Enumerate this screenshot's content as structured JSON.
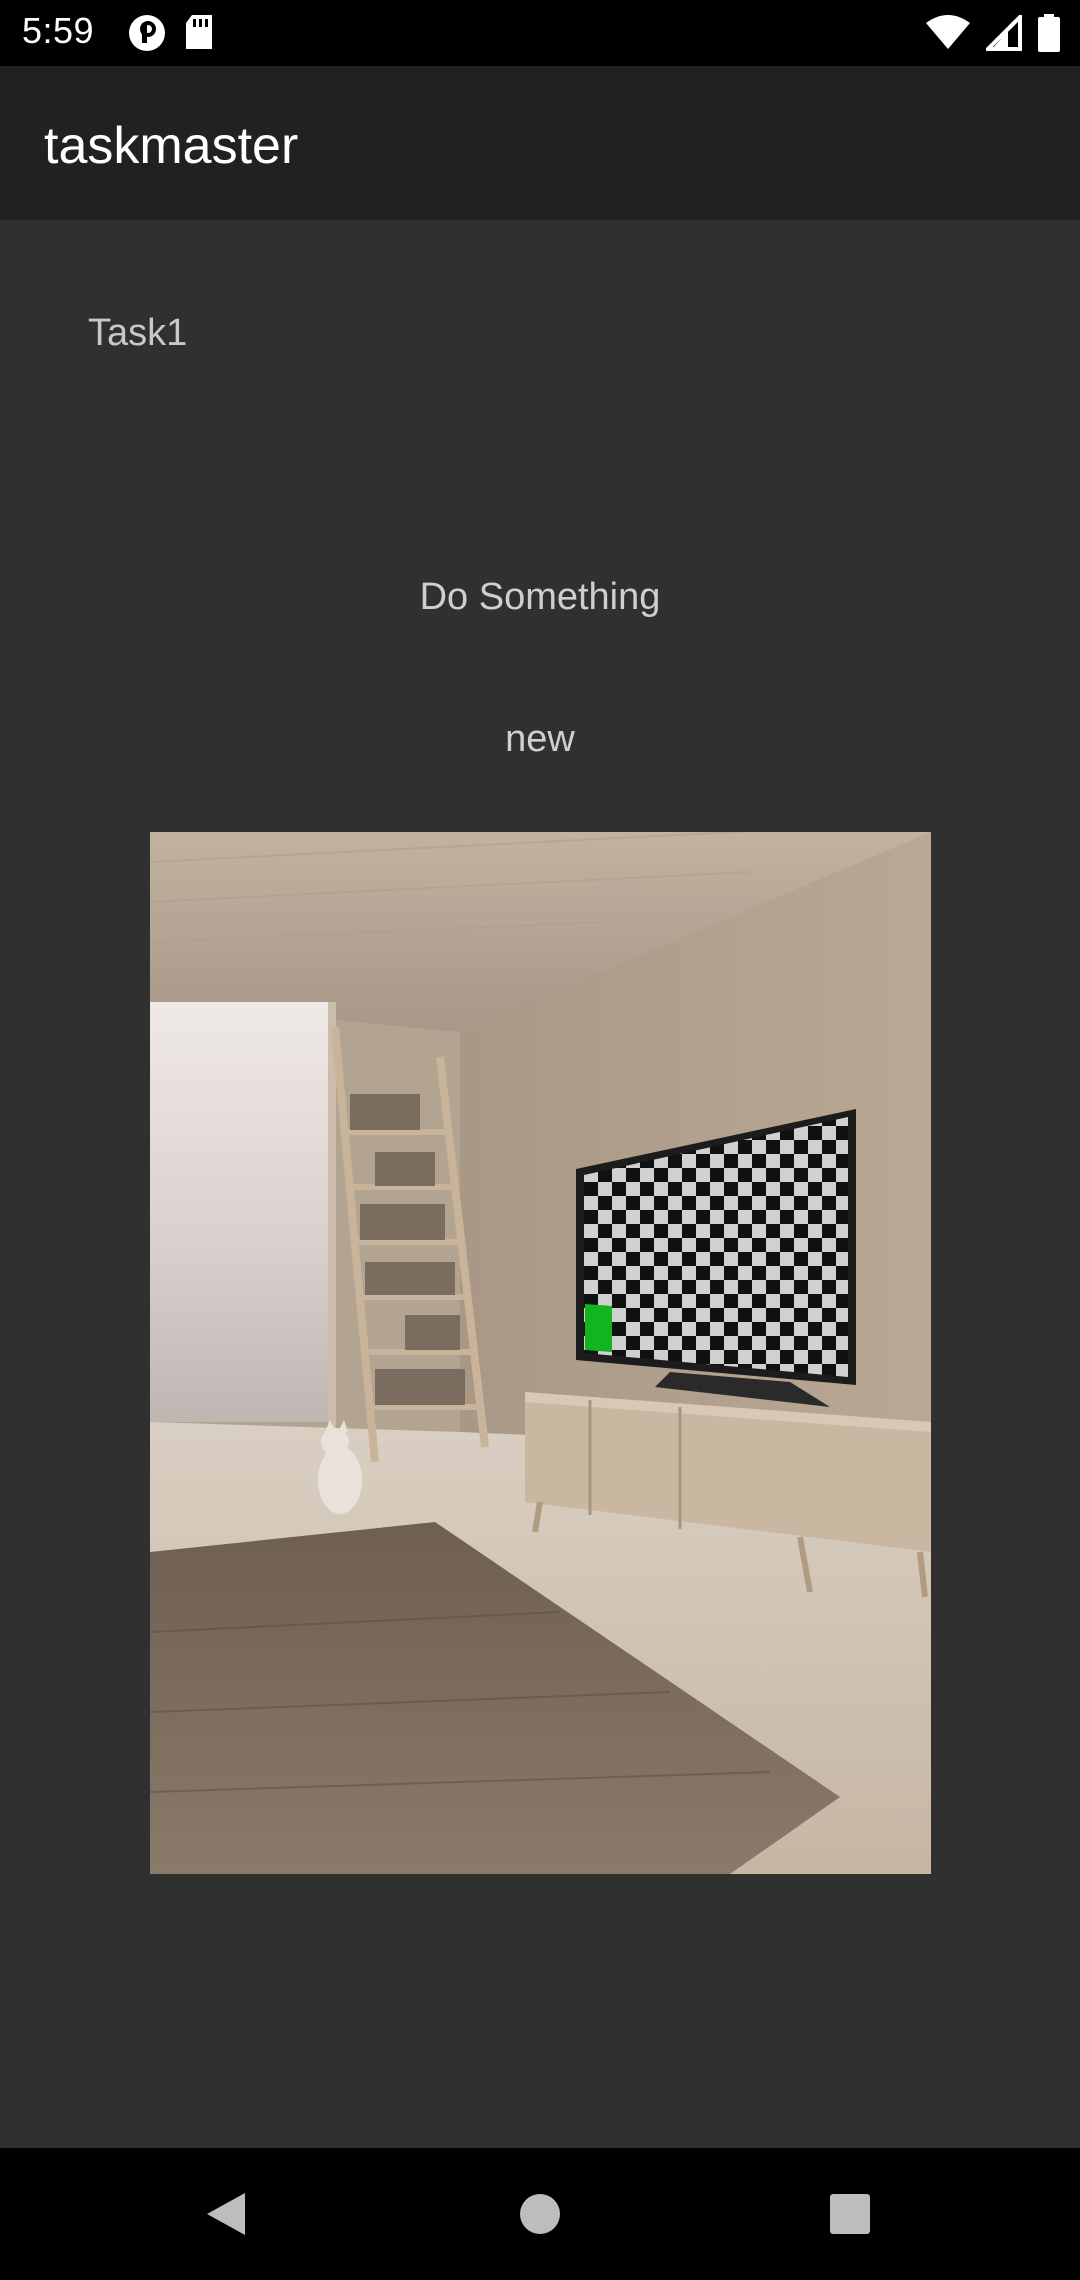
{
  "status_bar": {
    "time": "5:59",
    "left_icons": [
      "notification-p-icon",
      "sd-card-icon"
    ],
    "right_icons": [
      "wifi-icon",
      "cell-signal-icon",
      "battery-icon"
    ]
  },
  "app_bar": {
    "title": "taskmaster"
  },
  "task": {
    "title": "Task1",
    "body": "Do Something",
    "state": "new",
    "image": {
      "description_icon": "room-photo",
      "accent_color": "#12b51f"
    }
  },
  "nav_bar": {
    "buttons": [
      "back-icon",
      "home-icon",
      "recents-icon"
    ]
  },
  "colors": {
    "background": "#303030",
    "app_bar": "#212121",
    "text_primary": "#ffffff",
    "text_secondary": "#cfcfcf"
  }
}
